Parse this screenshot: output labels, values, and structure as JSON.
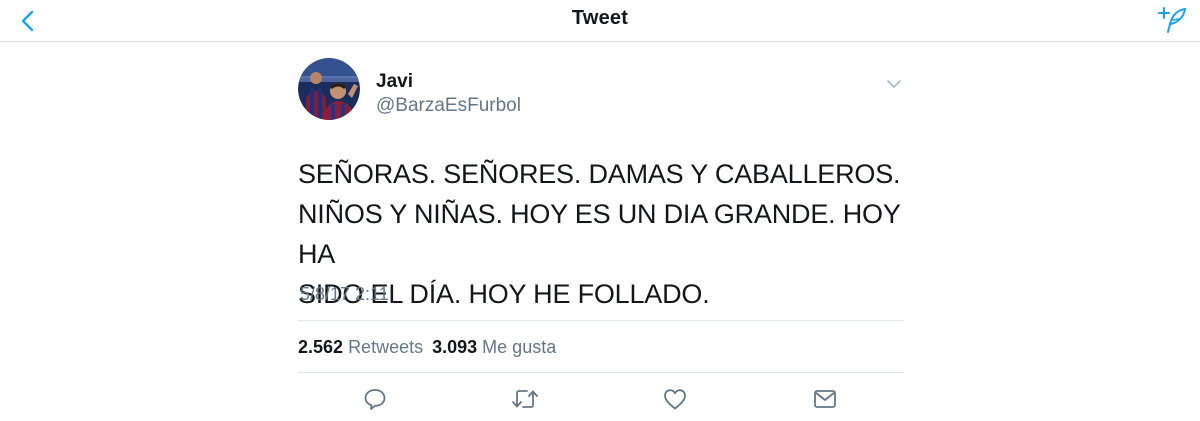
{
  "navbar": {
    "title": "Tweet",
    "back_icon": "chevron-left-icon",
    "compose_icon": "compose-tweet-icon",
    "accent_color": "#1da1f2"
  },
  "tweet": {
    "author": {
      "display_name": "Javi",
      "handle": "@BarzaEsFurbol"
    },
    "text_lines": [
      "SEÑORAS. SEÑORES. DAMAS Y CABALLEROS.",
      "NIÑOS Y NIÑAS. HOY ES UN DIA GRANDE. HOY HA",
      "SIDO EL DÍA. HOY HE FOLLADO."
    ],
    "timestamp": "5/8/17 2:11",
    "stats": {
      "retweets_count": "2.562",
      "retweets_label": "Retweets",
      "likes_count": "3.093",
      "likes_label": "Me gusta"
    },
    "actions": [
      "reply-icon",
      "retweet-icon",
      "like-icon",
      "direct-message-icon"
    ]
  },
  "colors": {
    "text_primary": "#14171a",
    "text_secondary": "#657786",
    "icon_gray": "#657786",
    "divider": "#e1e8ed"
  }
}
